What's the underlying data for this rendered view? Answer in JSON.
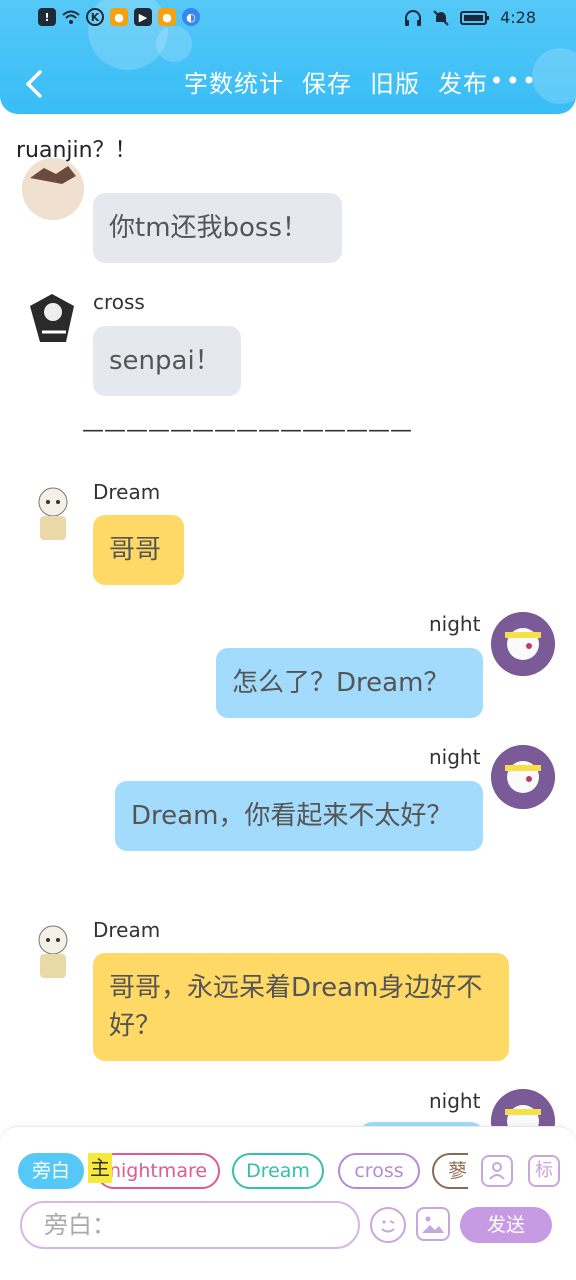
{
  "status": {
    "time": "4:28",
    "left_icons": [
      "alert-icon",
      "wifi-icon",
      "k-app-icon",
      "weibo-icon",
      "b-app-icon",
      "weibo-icon",
      "browser-icon"
    ],
    "right_icons": [
      "headphones-icon",
      "bell-muted-icon",
      "battery-icon"
    ]
  },
  "nav": {
    "word_count": "字数统计",
    "save": "保存",
    "old_version": "旧版",
    "publish": "发布",
    "more": "•••"
  },
  "chat": {
    "narration_top": "ruanjin？！",
    "messages": [
      {
        "side": "left",
        "name": "",
        "text": "你tm还我boss！"
      },
      {
        "side": "left",
        "name": "cross",
        "text": "senpai！"
      },
      {
        "divider": "———————————————"
      },
      {
        "side": "left",
        "name": "Dream",
        "text": "哥哥"
      },
      {
        "side": "right",
        "name": "night",
        "text": "怎么了？Dream？"
      },
      {
        "side": "right",
        "name": "night",
        "text": "Dream，你看起来不太好？"
      },
      {
        "side": "left",
        "name": "Dream",
        "text": "哥哥，永远呆着Dream身边好不好？"
      },
      {
        "side": "right",
        "name": "night",
        "text": ""
      }
    ]
  },
  "composer": {
    "chips": {
      "narration": "旁白",
      "main_tag": "主",
      "nightmare": "nightmare",
      "dream": "Dream",
      "cross": "cross",
      "more": "蓼"
    },
    "side_icons": {
      "person": "user-card-icon",
      "tag": "标"
    },
    "placeholder": "旁白：",
    "send": "发送"
  },
  "colors": {
    "header": "#38bdf6",
    "gray_bubble": "#e5e9ef",
    "yellow_bubble": "#ffd966",
    "blue_bubble": "#a2dbfb",
    "send": "#c79be3"
  }
}
